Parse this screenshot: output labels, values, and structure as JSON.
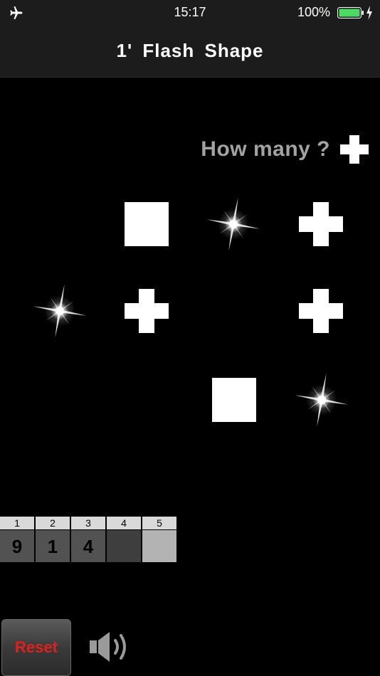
{
  "status_bar": {
    "time": "15:17",
    "battery_percent": "100%",
    "battery_level": 1.0,
    "battery_color": "#4cd964",
    "icons": [
      "airplane-icon",
      "battery-icon",
      "charging-bolt-icon"
    ]
  },
  "nav": {
    "title": "1'  Flash  Shape"
  },
  "question": {
    "text": "How many ?",
    "target_shape": "cross"
  },
  "grid": {
    "rows": [
      [
        "empty",
        "square",
        "flash",
        "cross"
      ],
      [
        "flash",
        "cross",
        "empty",
        "cross"
      ],
      [
        "empty",
        "empty",
        "square",
        "flash"
      ]
    ]
  },
  "answers": {
    "headers": [
      "1",
      "2",
      "3",
      "4",
      "5"
    ],
    "values": [
      "9",
      "1",
      "4",
      "",
      ""
    ]
  },
  "controls": {
    "reset_label": "Reset",
    "reset_color": "#e0201b",
    "speaker_icon": "speaker-icon"
  }
}
